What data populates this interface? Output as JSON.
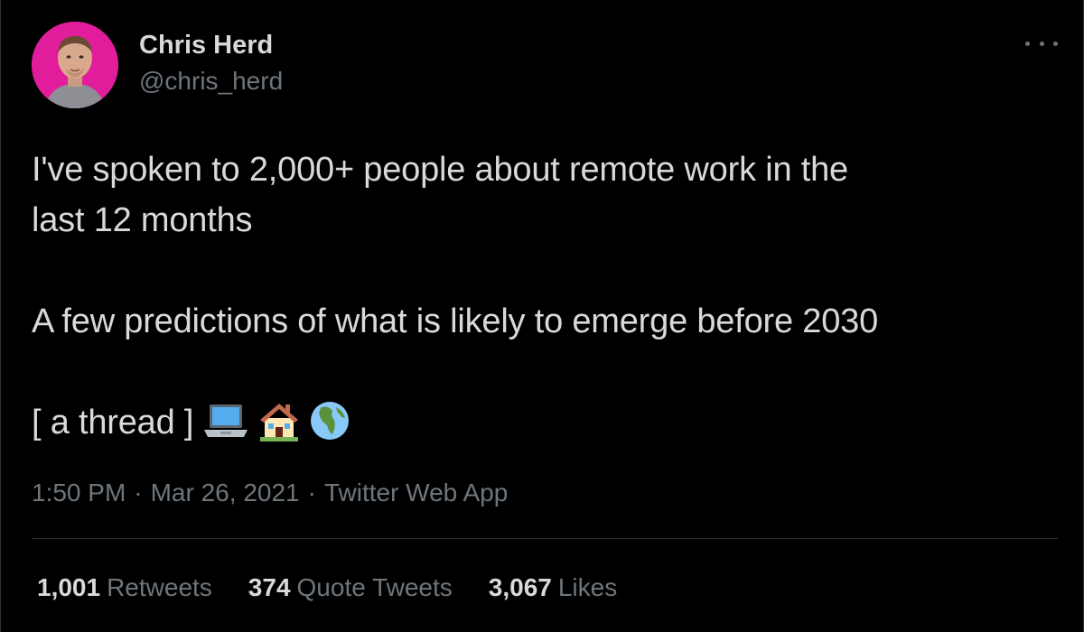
{
  "author": {
    "display_name": "Chris Herd",
    "handle": "@chris_herd",
    "avatar_bg": "#e21d9b"
  },
  "tweet": {
    "line1": "I've spoken to 2,000+ people about remote work in the",
    "line2": "last 12 months",
    "line3": "A few predictions of what is likely to emerge before 2030",
    "line4": "[ a thread ]",
    "emojis": [
      "laptop-icon",
      "house-icon",
      "globe-icon"
    ]
  },
  "meta": {
    "time": "1:50 PM",
    "separator": "·",
    "date": "Mar 26, 2021",
    "source": "Twitter Web App"
  },
  "stats": {
    "retweets_count": "1,001",
    "retweets_label": "Retweets",
    "quotes_count": "374",
    "quotes_label": "Quote Tweets",
    "likes_count": "3,067",
    "likes_label": "Likes"
  },
  "colors": {
    "background": "#000000",
    "primary_text": "#d9d9d9",
    "secondary_text": "#6e767d",
    "divider": "#2f3336"
  }
}
